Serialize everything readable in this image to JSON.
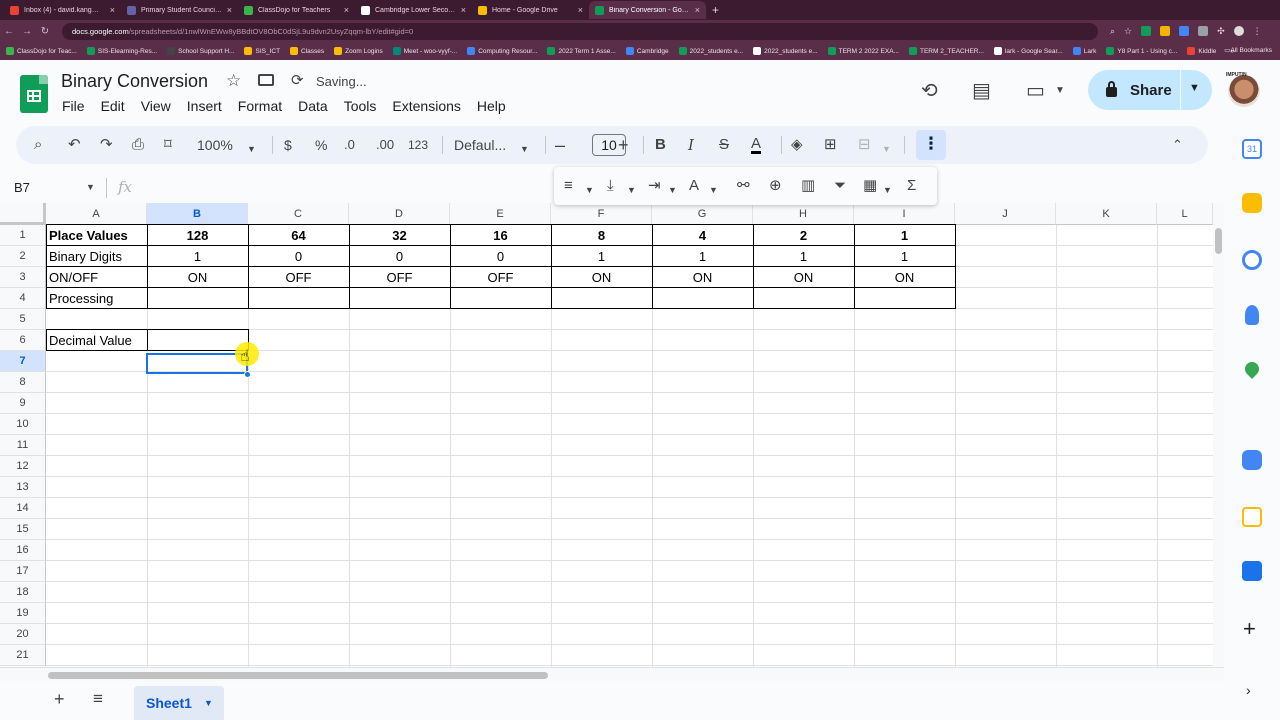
{
  "browser": {
    "tabs": [
      {
        "title": "Inbox (4) - david.kang@stellr",
        "color": "#ea4335"
      },
      {
        "title": "Primary Student Council Pres",
        "color": "#6264a7"
      },
      {
        "title": "ClassDojo for Teachers",
        "color": "#3ab54a"
      },
      {
        "title": "Cambridge Lower Secondary",
        "color": "#ffffff"
      },
      {
        "title": "Home - Google Drive",
        "color": "#fbbc04"
      },
      {
        "title": "Binary Conversion - Google S",
        "color": "#0f9d58"
      }
    ],
    "new_tab_label": "+",
    "url_domain": "docs.google.com",
    "url_rest": "/spreadsheets/d/1nwlWnEWw8yBBdtOV8ObC0dSjL9u9dvn2UsyZqqm-lbY/edit#gid=0",
    "bookmarks": [
      {
        "label": "ClassDojo for Teac...",
        "color": "#3ab54a"
      },
      {
        "label": "SIS-Elearning-Res...",
        "color": "#0f9d58"
      },
      {
        "label": "School Support H...",
        "color": "#444444"
      },
      {
        "label": "SIS_ICT",
        "color": "#fbbc04"
      },
      {
        "label": "Classes",
        "color": "#fbbc04"
      },
      {
        "label": "Zoom Logins",
        "color": "#fbbc04"
      },
      {
        "label": "Meet - woo-vyyf-...",
        "color": "#00897b"
      },
      {
        "label": "Computing Resour...",
        "color": "#4285f4"
      },
      {
        "label": "2022 Term 1 Asse...",
        "color": "#0f9d58"
      },
      {
        "label": "Cambridge",
        "color": "#4285f4"
      },
      {
        "label": "2022_students e...",
        "color": "#0f9d58"
      },
      {
        "label": "2022_students e...",
        "color": "#ffffff"
      },
      {
        "label": "TERM 2 2022 EXA...",
        "color": "#0f9d58"
      },
      {
        "label": "TERM 2_TEACHER...",
        "color": "#0f9d58"
      },
      {
        "label": "lark - Google Sear...",
        "color": "#ffffff"
      },
      {
        "label": "Lark",
        "color": "#4285f4"
      },
      {
        "label": "Y8 Part 1 - Using c...",
        "color": "#0f9d58"
      },
      {
        "label": "Kiddle",
        "color": "#ea4335"
      }
    ],
    "bookmarks_more": "»",
    "all_bookmarks": "All Bookmarks"
  },
  "app": {
    "title": "Binary Conversion",
    "status": "Saving...",
    "menu": [
      "File",
      "Edit",
      "View",
      "Insert",
      "Format",
      "Data",
      "Tools",
      "Extensions",
      "Help"
    ],
    "share_label": "Share",
    "avatar_label": "IMPUTIN"
  },
  "toolbar": {
    "zoom": "100%",
    "currency": "$",
    "percent": "%",
    "decrease_decimal": ".0",
    "increase_decimal": ".00",
    "number_format": "123",
    "font": "Defaul...",
    "font_size": "10",
    "bold": "B",
    "italic": "I",
    "strike": "S",
    "text_color": "A",
    "more": "⋮"
  },
  "formula_bar": {
    "name_box": "B7",
    "fx": "fx",
    "value": ""
  },
  "grid": {
    "columns": [
      "A",
      "B",
      "C",
      "D",
      "E",
      "F",
      "G",
      "H",
      "I",
      "J",
      "K",
      "L"
    ],
    "selected_column": "B",
    "rows": [
      "1",
      "2",
      "3",
      "4",
      "5",
      "6",
      "7",
      "8",
      "9",
      "10",
      "11",
      "12",
      "13",
      "14",
      "15",
      "16",
      "17",
      "18",
      "19",
      "20",
      "21"
    ],
    "selected_row": "7",
    "table": [
      {
        "label": "Place Values",
        "bold": true,
        "values": [
          "128",
          "64",
          "32",
          "16",
          "8",
          "4",
          "2",
          "1"
        ]
      },
      {
        "label": "Binary Digits",
        "bold": false,
        "values": [
          "1",
          "0",
          "0",
          "0",
          "1",
          "1",
          "1",
          "1"
        ]
      },
      {
        "label": "ON/OFF",
        "bold": false,
        "values": [
          "ON",
          "OFF",
          "OFF",
          "OFF",
          "ON",
          "ON",
          "ON",
          "ON"
        ]
      },
      {
        "label": "Processing",
        "bold": false,
        "values": [
          "",
          "",
          "",
          "",
          "",
          "",
          "",
          ""
        ]
      }
    ],
    "decimal_label": "Decimal Value",
    "decimal_value": ""
  },
  "sheets": {
    "add": "+",
    "list": "≡",
    "active": "Sheet1"
  }
}
